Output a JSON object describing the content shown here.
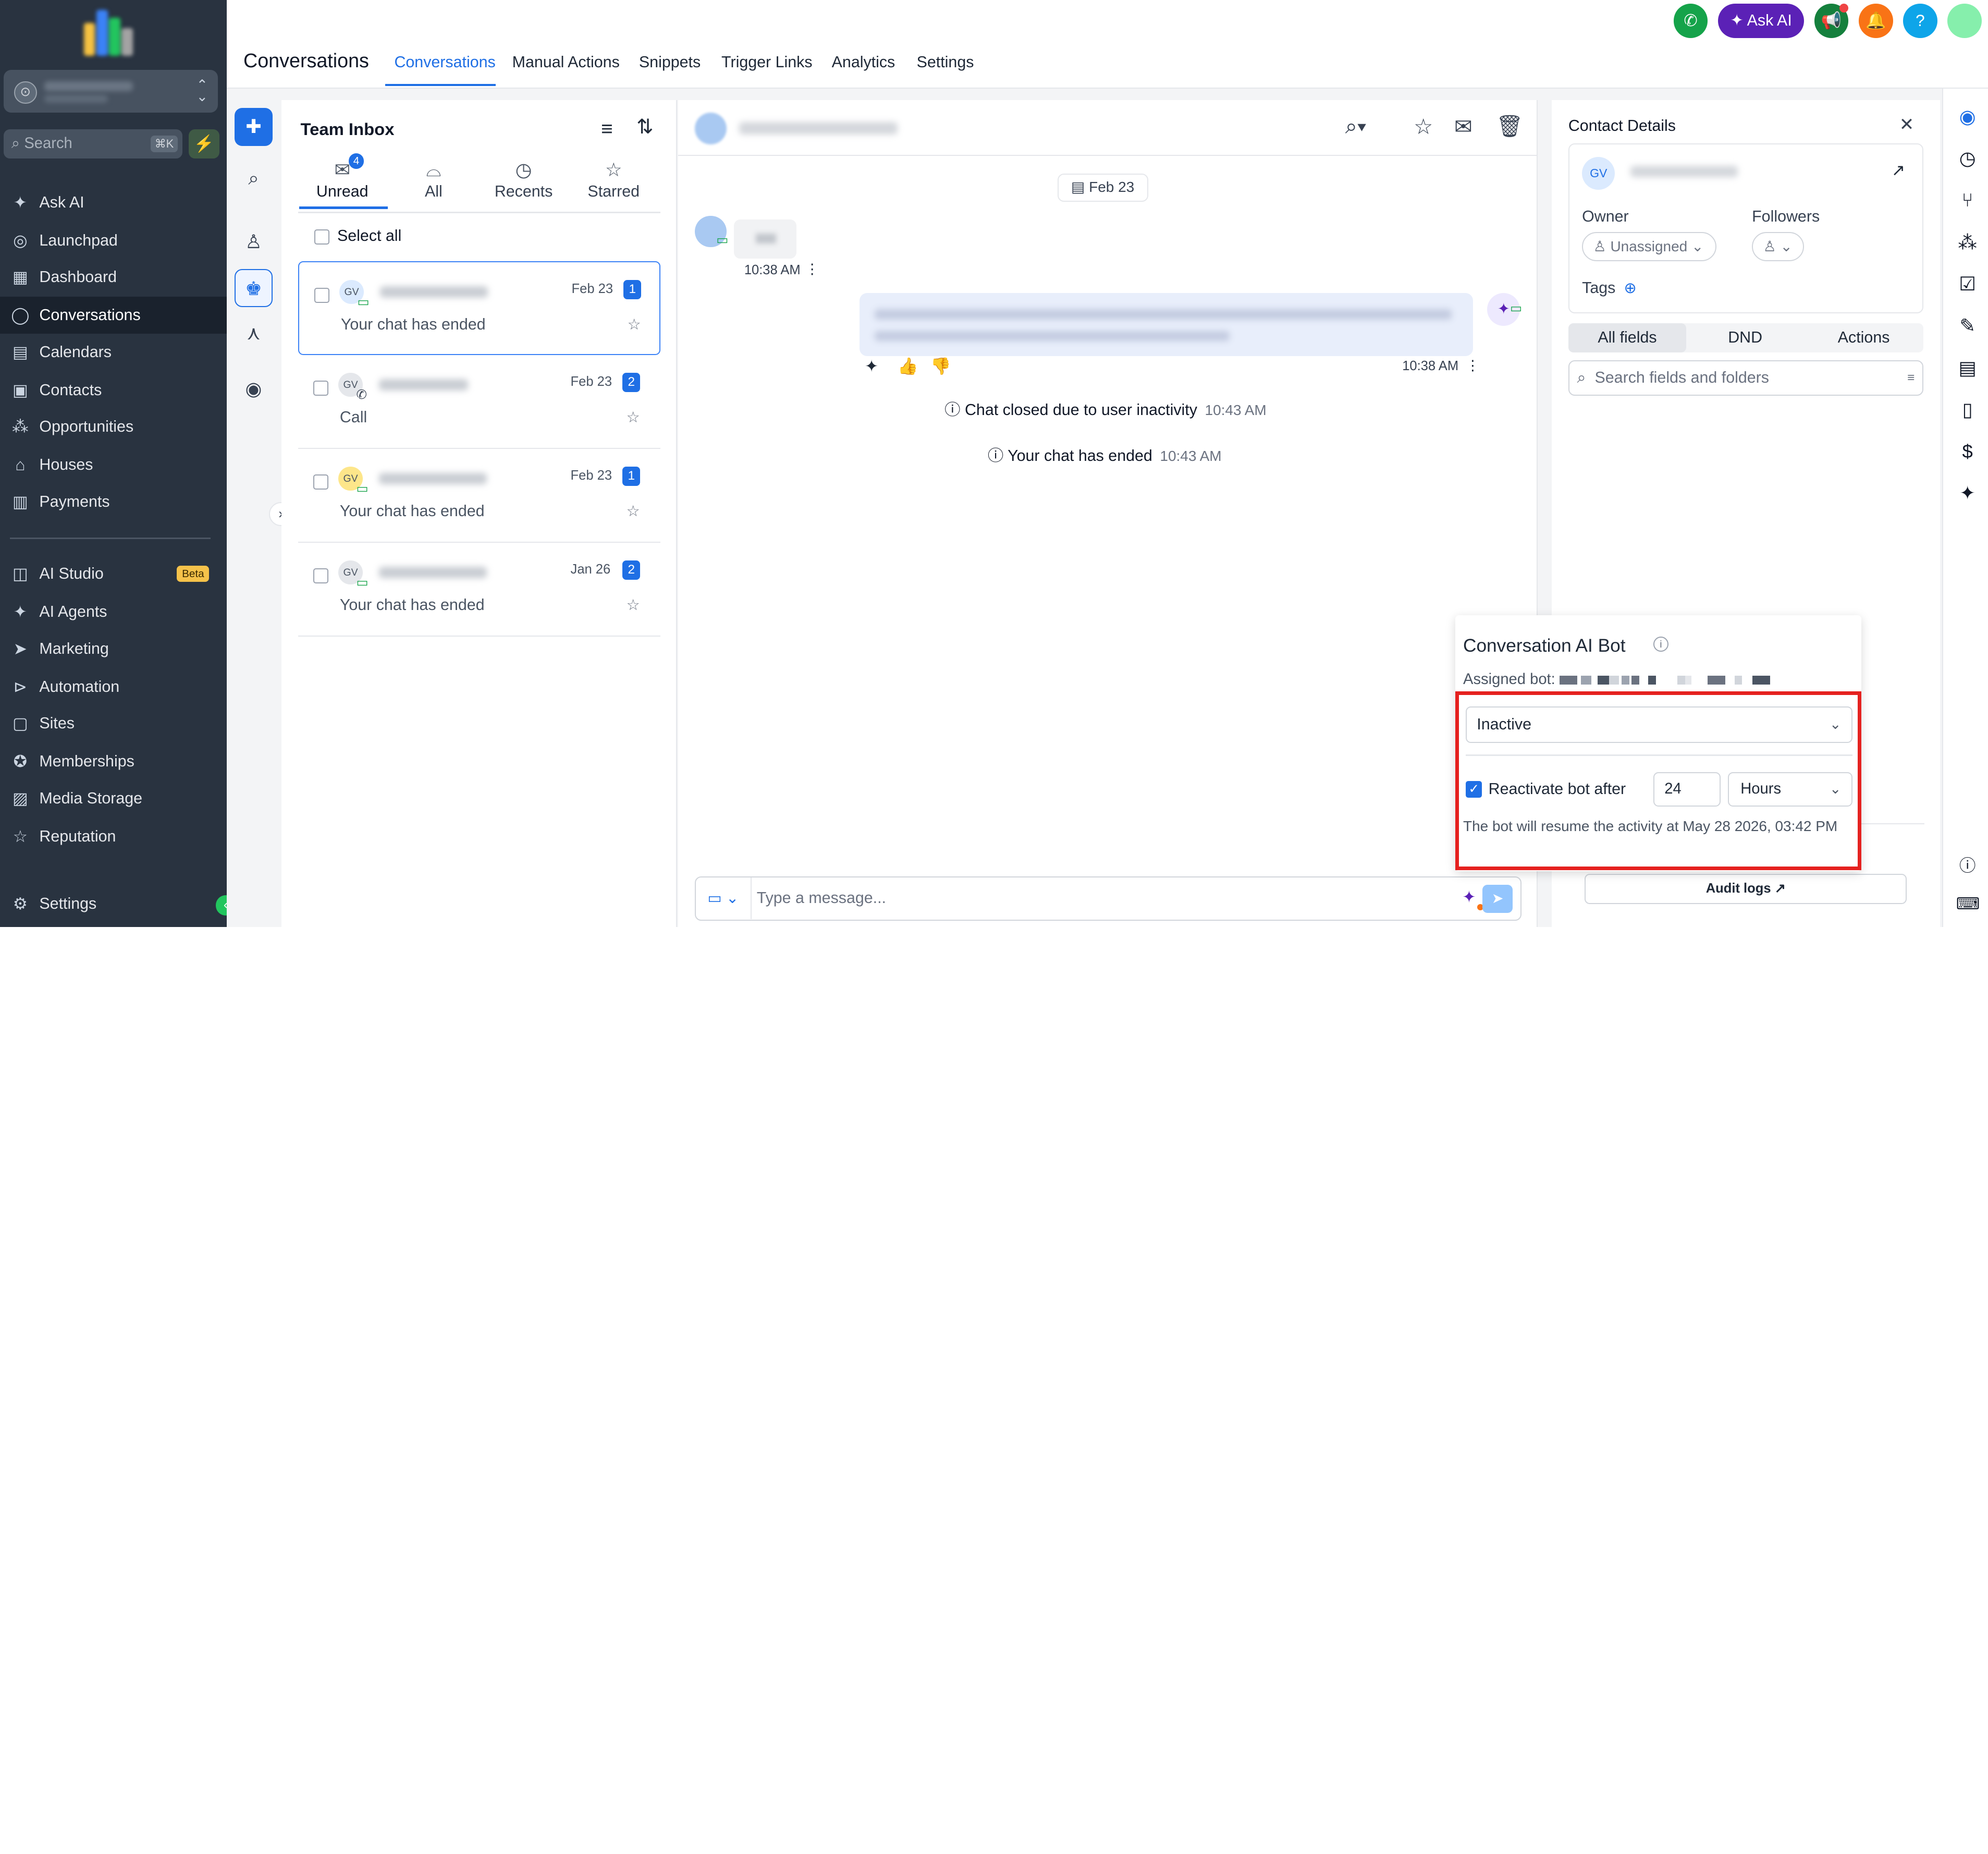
{
  "sidebar": {
    "search_placeholder": "Search",
    "search_shortcut": "⌘K",
    "items": [
      {
        "label": "Ask AI",
        "icon": "sparkle-icon"
      },
      {
        "label": "Launchpad",
        "icon": "rocket-icon"
      },
      {
        "label": "Dashboard",
        "icon": "grid-icon"
      },
      {
        "label": "Conversations",
        "icon": "chat-icon"
      },
      {
        "label": "Calendars",
        "icon": "calendar-icon"
      },
      {
        "label": "Contacts",
        "icon": "contacts-icon"
      },
      {
        "label": "Opportunities",
        "icon": "opportunities-icon"
      },
      {
        "label": "Houses",
        "icon": "house-icon"
      },
      {
        "label": "Payments",
        "icon": "payments-icon"
      },
      {
        "label": "AI Studio",
        "icon": "ai-studio-icon",
        "badge": "Beta"
      },
      {
        "label": "AI Agents",
        "icon": "sparkle-icon"
      },
      {
        "label": "Marketing",
        "icon": "send-icon"
      },
      {
        "label": "Automation",
        "icon": "automation-icon"
      },
      {
        "label": "Sites",
        "icon": "sites-icon"
      },
      {
        "label": "Memberships",
        "icon": "membership-icon"
      },
      {
        "label": "Media Storage",
        "icon": "image-icon"
      },
      {
        "label": "Reputation",
        "icon": "star-icon"
      }
    ],
    "settings_label": "Settings"
  },
  "header": {
    "title": "Conversations",
    "tabs": [
      "Conversations",
      "Manual Actions",
      "Snippets",
      "Trigger Links",
      "Analytics",
      "Settings"
    ],
    "ask_ai_label": "Ask AI"
  },
  "inbox": {
    "title": "Team Inbox",
    "tabs": [
      {
        "label": "Unread",
        "count": "4"
      },
      {
        "label": "All"
      },
      {
        "label": "Recents"
      },
      {
        "label": "Starred"
      }
    ],
    "select_all": "Select all",
    "conversations": [
      {
        "initials": "GV",
        "date": "Feb 23",
        "count": "1",
        "preview": "Your chat has ended",
        "channel": "chat-icon"
      },
      {
        "initials": "GV",
        "date": "Feb 23",
        "count": "2",
        "preview": "Call",
        "channel": "phone-icon"
      },
      {
        "initials": "GV",
        "date": "Feb 23",
        "count": "1",
        "preview": "Your chat has ended",
        "channel": "chat-icon"
      },
      {
        "initials": "GV",
        "date": "Jan 26",
        "count": "2",
        "preview": "Your chat has ended",
        "channel": "chat-icon"
      }
    ]
  },
  "chat": {
    "date_divider": "Feb 23",
    "incoming_time": "10:38 AM",
    "outgoing_time": "10:38 AM",
    "system_messages": [
      {
        "text": "Chat closed due to user inactivity",
        "time": "10:43 AM"
      },
      {
        "text": "Your chat has ended",
        "time": "10:43 AM"
      }
    ],
    "composer_placeholder": "Type a message..."
  },
  "contact": {
    "title": "Contact Details",
    "initials": "GV",
    "owner_label": "Owner",
    "owner_value": "Unassigned",
    "followers_label": "Followers",
    "tags_label": "Tags",
    "segments": [
      "All fields",
      "DND",
      "Actions"
    ],
    "search_placeholder": "Search fields and folders",
    "audit_logs": "Audit logs"
  },
  "bot": {
    "title": "Conversation AI Bot",
    "assigned_label": "Assigned bot:",
    "status": "Inactive",
    "reactivate_label": "Reactivate bot after",
    "reactivate_checked": true,
    "reactivate_value": "24",
    "unit": "Hours",
    "note": "The bot will resume the activity at May 28 2026, 03:42 PM"
  },
  "colors": {
    "accent": "#1f6fe5",
    "sidebar_bg": "#293340",
    "highlight_border": "#e5211f",
    "ask_ai_bg": "#5b21b6"
  }
}
